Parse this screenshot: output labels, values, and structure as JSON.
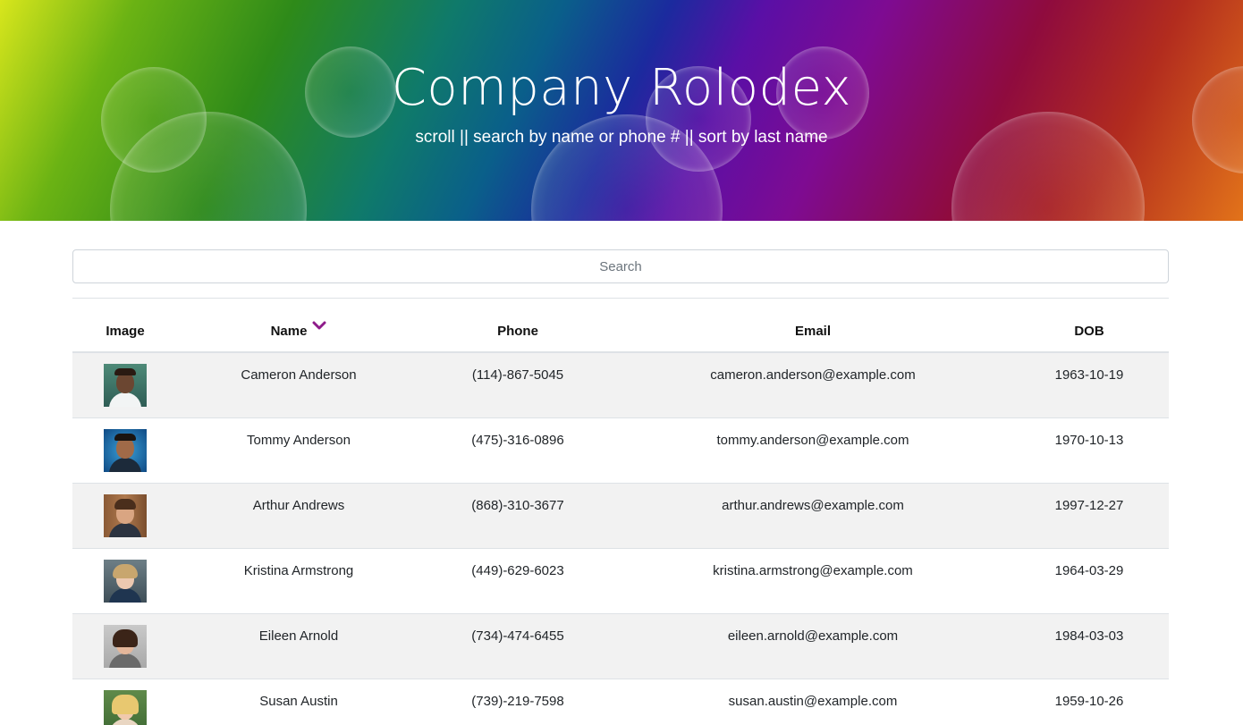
{
  "header": {
    "title": "Company Rolodex",
    "subtitle": "scroll || search by name or phone # || sort by last name"
  },
  "search": {
    "placeholder": "Search",
    "value": ""
  },
  "table": {
    "columns": {
      "image": "Image",
      "name": "Name",
      "phone": "Phone",
      "email": "Email",
      "dob": "DOB"
    },
    "sort_indicator": "chevron-down-icon",
    "accent_color": "#8e1b8a",
    "rows": [
      {
        "name": "Cameron Anderson",
        "phone": "(114)-867-5045",
        "email": "cameron.anderson@example.com",
        "dob": "1963-10-19",
        "avatar": "person-photo-icon"
      },
      {
        "name": "Tommy Anderson",
        "phone": "(475)-316-0896",
        "email": "tommy.anderson@example.com",
        "dob": "1970-10-13",
        "avatar": "person-photo-icon"
      },
      {
        "name": "Arthur Andrews",
        "phone": "(868)-310-3677",
        "email": "arthur.andrews@example.com",
        "dob": "1997-12-27",
        "avatar": "person-photo-icon"
      },
      {
        "name": "Kristina Armstrong",
        "phone": "(449)-629-6023",
        "email": "kristina.armstrong@example.com",
        "dob": "1964-03-29",
        "avatar": "person-photo-icon"
      },
      {
        "name": "Eileen Arnold",
        "phone": "(734)-474-6455",
        "email": "eileen.arnold@example.com",
        "dob": "1984-03-03",
        "avatar": "person-photo-icon"
      },
      {
        "name": "Susan Austin",
        "phone": "(739)-219-7598",
        "email": "susan.austin@example.com",
        "dob": "1959-10-26",
        "avatar": "person-photo-icon"
      }
    ]
  }
}
